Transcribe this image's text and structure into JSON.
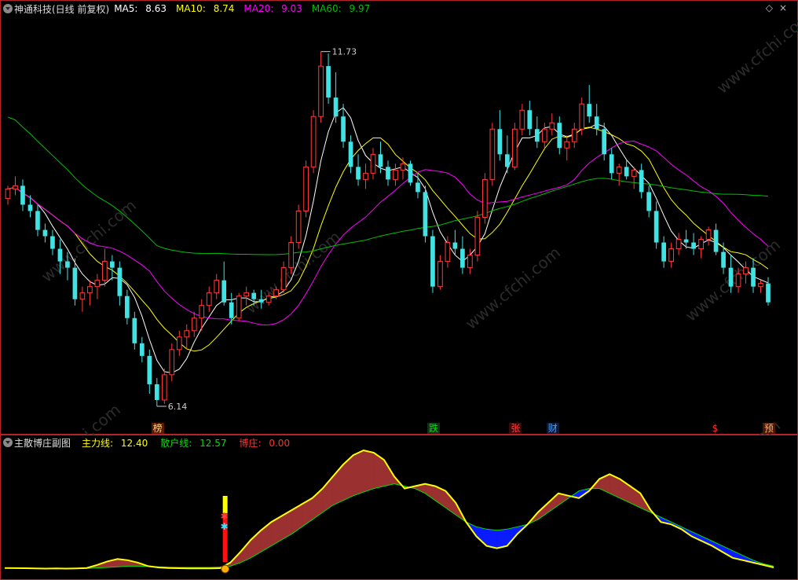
{
  "main": {
    "title": "神通科技(日线 前复权)",
    "ma": [
      {
        "label": "MA5:",
        "value": "8.63",
        "color": "#ffffff"
      },
      {
        "label": "MA10:",
        "value": "8.74",
        "color": "#ffff00"
      },
      {
        "label": "MA20:",
        "value": "9.03",
        "color": "#ff00ff"
      },
      {
        "label": "MA60:",
        "value": "9.97",
        "color": "#00c000"
      }
    ],
    "high_label": "11.73",
    "low_label": "6.14",
    "price_range": [
      6.0,
      12.05
    ],
    "signals": [
      {
        "text": "榜",
        "color": "#ffd27f",
        "bg": "#5a1a00"
      },
      {
        "text": "跌",
        "color": "#00e000",
        "bg": "#10301a"
      },
      {
        "text": "张",
        "color": "#ff4040",
        "bg": "#3a0a0a"
      },
      {
        "text": "财",
        "color": "#40a0ff",
        "bg": "#0a1a3a"
      },
      {
        "text": "$",
        "color": "#ff3030",
        "bg": "#000000"
      },
      {
        "text": "预",
        "color": "#ffb060",
        "bg": "#4a1800"
      }
    ],
    "watermark": "www.cfchi.com",
    "candles": [
      [
        9.4,
        9.6,
        9.3,
        9.55
      ],
      [
        9.55,
        9.75,
        9.45,
        9.6
      ],
      [
        9.6,
        9.7,
        9.2,
        9.3
      ],
      [
        9.3,
        9.45,
        9.1,
        9.2
      ],
      [
        9.2,
        9.3,
        8.8,
        8.9
      ],
      [
        8.9,
        9.0,
        8.7,
        8.8
      ],
      [
        8.8,
        8.9,
        8.5,
        8.6
      ],
      [
        8.6,
        8.75,
        8.2,
        8.4
      ],
      [
        8.4,
        8.55,
        8.1,
        8.3
      ],
      [
        8.3,
        8.45,
        7.7,
        7.8
      ],
      [
        7.8,
        8.0,
        7.6,
        7.9
      ],
      [
        7.9,
        8.1,
        7.7,
        8.0
      ],
      [
        8.0,
        8.2,
        7.8,
        8.1
      ],
      [
        8.1,
        8.6,
        8.0,
        8.4
      ],
      [
        8.4,
        8.5,
        8.1,
        8.3
      ],
      [
        8.3,
        8.4,
        7.7,
        7.85
      ],
      [
        7.85,
        7.95,
        7.4,
        7.5
      ],
      [
        7.5,
        7.6,
        7.0,
        7.1
      ],
      [
        7.1,
        7.2,
        6.8,
        6.9
      ],
      [
        6.9,
        7.0,
        6.3,
        6.45
      ],
      [
        6.45,
        6.55,
        6.1,
        6.2
      ],
      [
        6.2,
        6.7,
        6.14,
        6.6
      ],
      [
        6.6,
        7.1,
        6.5,
        7.0
      ],
      [
        7.0,
        7.3,
        6.9,
        7.2
      ],
      [
        7.2,
        7.4,
        7.0,
        7.3
      ],
      [
        7.3,
        7.6,
        7.2,
        7.5
      ],
      [
        7.5,
        7.8,
        7.3,
        7.7
      ],
      [
        7.7,
        8.0,
        7.6,
        7.9
      ],
      [
        7.9,
        8.2,
        7.8,
        8.1
      ],
      [
        8.1,
        8.4,
        7.7,
        7.75
      ],
      [
        7.75,
        7.9,
        7.4,
        7.5
      ],
      [
        7.5,
        7.9,
        7.45,
        7.85
      ],
      [
        7.85,
        8.0,
        7.7,
        7.9
      ],
      [
        7.9,
        7.95,
        7.7,
        7.8
      ],
      [
        7.8,
        7.95,
        7.65,
        7.75
      ],
      [
        7.75,
        7.9,
        7.7,
        7.85
      ],
      [
        7.85,
        8.0,
        7.8,
        7.95
      ],
      [
        7.95,
        8.4,
        7.9,
        8.3
      ],
      [
        8.3,
        8.8,
        8.2,
        8.7
      ],
      [
        8.7,
        9.3,
        8.6,
        9.2
      ],
      [
        9.2,
        10.0,
        9.1,
        9.9
      ],
      [
        9.9,
        10.8,
        9.8,
        10.7
      ],
      [
        10.7,
        11.73,
        10.6,
        11.5
      ],
      [
        11.5,
        11.7,
        10.9,
        11.0
      ],
      [
        11.0,
        11.4,
        10.6,
        10.7
      ],
      [
        10.7,
        10.9,
        10.2,
        10.3
      ],
      [
        10.3,
        10.4,
        9.8,
        9.9
      ],
      [
        9.9,
        10.1,
        9.6,
        9.7
      ],
      [
        9.7,
        9.95,
        9.55,
        9.8
      ],
      [
        9.8,
        10.2,
        9.7,
        10.1
      ],
      [
        10.1,
        10.3,
        9.8,
        9.9
      ],
      [
        9.9,
        10.0,
        9.6,
        9.7
      ],
      [
        9.7,
        9.95,
        9.6,
        9.85
      ],
      [
        9.85,
        10.05,
        9.7,
        9.95
      ],
      [
        9.95,
        10.0,
        9.6,
        9.65
      ],
      [
        9.65,
        9.8,
        9.4,
        9.5
      ],
      [
        9.5,
        9.6,
        8.7,
        8.8
      ],
      [
        8.8,
        8.9,
        7.9,
        8.0
      ],
      [
        8.0,
        8.5,
        7.95,
        8.4
      ],
      [
        8.4,
        8.8,
        8.3,
        8.7
      ],
      [
        8.7,
        8.9,
        8.5,
        8.6
      ],
      [
        8.6,
        8.8,
        8.2,
        8.3
      ],
      [
        8.3,
        8.6,
        8.2,
        8.5
      ],
      [
        8.5,
        9.2,
        8.4,
        9.1
      ],
      [
        9.1,
        9.8,
        9.0,
        9.7
      ],
      [
        9.7,
        10.6,
        9.6,
        10.5
      ],
      [
        10.5,
        10.8,
        10.0,
        10.1
      ],
      [
        10.1,
        10.4,
        9.8,
        9.9
      ],
      [
        9.9,
        10.6,
        9.85,
        10.5
      ],
      [
        10.5,
        10.9,
        10.4,
        10.8
      ],
      [
        10.8,
        10.95,
        10.4,
        10.5
      ],
      [
        10.5,
        10.7,
        10.2,
        10.3
      ],
      [
        10.3,
        10.6,
        10.2,
        10.5
      ],
      [
        10.5,
        10.75,
        10.4,
        10.6
      ],
      [
        10.6,
        10.7,
        10.1,
        10.2
      ],
      [
        10.2,
        10.4,
        10.0,
        10.3
      ],
      [
        10.3,
        10.6,
        10.2,
        10.5
      ],
      [
        10.5,
        11.0,
        10.4,
        10.9
      ],
      [
        10.9,
        11.2,
        10.6,
        10.7
      ],
      [
        10.7,
        10.9,
        10.4,
        10.5
      ],
      [
        10.5,
        10.6,
        10.0,
        10.1
      ],
      [
        10.1,
        10.2,
        9.7,
        9.8
      ],
      [
        9.8,
        9.95,
        9.6,
        9.9
      ],
      [
        9.9,
        10.0,
        9.7,
        9.75
      ],
      [
        9.75,
        9.9,
        9.55,
        9.85
      ],
      [
        9.85,
        9.95,
        9.4,
        9.5
      ],
      [
        9.5,
        9.6,
        9.1,
        9.2
      ],
      [
        9.2,
        9.35,
        8.6,
        8.7
      ],
      [
        8.7,
        8.8,
        8.3,
        8.4
      ],
      [
        8.4,
        8.7,
        8.3,
        8.6
      ],
      [
        8.6,
        8.85,
        8.5,
        8.75
      ],
      [
        8.75,
        8.9,
        8.6,
        8.7
      ],
      [
        8.7,
        8.85,
        8.5,
        8.6
      ],
      [
        8.6,
        8.8,
        8.45,
        8.75
      ],
      [
        8.75,
        8.95,
        8.65,
        8.9
      ],
      [
        8.9,
        9.0,
        8.5,
        8.55
      ],
      [
        8.55,
        8.7,
        8.2,
        8.3
      ],
      [
        8.3,
        8.5,
        7.9,
        8.0
      ],
      [
        8.0,
        8.3,
        7.9,
        8.2
      ],
      [
        8.2,
        8.4,
        8.05,
        8.3
      ],
      [
        8.3,
        8.45,
        7.9,
        8.0
      ],
      [
        8.0,
        8.1,
        7.9,
        8.05
      ],
      [
        8.05,
        8.15,
        7.7,
        7.75
      ]
    ]
  },
  "sub": {
    "title": "主散博庄副图",
    "legend": [
      {
        "label": "主力线:",
        "value": "12.40",
        "color": "#ffff00"
      },
      {
        "label": "散户线:",
        "value": "12.57",
        "color": "#00e000"
      },
      {
        "label": "博庄:",
        "value": "0.00",
        "color": "#ff3030"
      }
    ],
    "yellow": [
      1.5,
      1.4,
      1.3,
      1.2,
      1.0,
      1.1,
      1.0,
      1.2,
      1.5,
      4,
      7,
      9,
      8,
      6,
      3,
      2,
      1.5,
      1.3,
      1.2,
      1.2,
      1.1,
      1.3,
      6,
      15,
      25,
      33,
      40,
      45,
      50,
      55,
      60,
      68,
      78,
      88,
      96,
      100,
      98,
      92,
      78,
      68,
      70,
      72,
      70,
      66,
      56,
      40,
      28,
      20,
      18,
      20,
      30,
      38,
      48,
      56,
      64,
      62,
      60,
      66,
      76,
      80,
      76,
      70,
      64,
      50,
      40,
      38,
      34,
      28,
      24,
      20,
      15,
      10,
      8,
      6,
      4,
      2
    ],
    "green": [
      1.5,
      1.4,
      1.3,
      1.2,
      1.1,
      1.1,
      1.0,
      1.0,
      1.2,
      1.6,
      2,
      2.5,
      3,
      3,
      2.8,
      2.5,
      2.2,
      2,
      2,
      2,
      2,
      2.3,
      3,
      6,
      10,
      15,
      20,
      25,
      30,
      36,
      42,
      48,
      54,
      58,
      62,
      65,
      68,
      70,
      72,
      70,
      68,
      64,
      58,
      52,
      46,
      40,
      36,
      34,
      33,
      34,
      36,
      38,
      42,
      48,
      54,
      60,
      66,
      68,
      68,
      64,
      60,
      56,
      52,
      48,
      44,
      40,
      36,
      32,
      28,
      24,
      20,
      16,
      12,
      8,
      5,
      3
    ]
  }
}
